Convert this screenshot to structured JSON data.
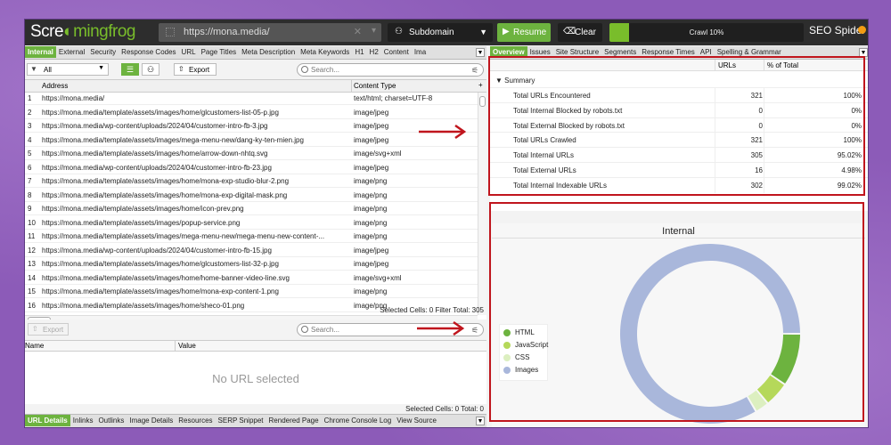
{
  "app": {
    "logo_pre": "Scre",
    "logo_mid": "ming",
    "logo_post": "frog",
    "url": "https://mona.media/",
    "mode": "Subdomain",
    "resume_label": "Resume",
    "clear_label": "Clear",
    "crawl_label": "Crawl 10%",
    "crawl_progress": 0.1,
    "product": "SEO Spider"
  },
  "left_tabs": [
    "Internal",
    "External",
    "Security",
    "Response Codes",
    "URL",
    "Page Titles",
    "Meta Description",
    "Meta Keywords",
    "H1",
    "H2",
    "Content",
    "Ima"
  ],
  "toolbar": {
    "filter": "All",
    "export_label": "Export",
    "search_placeholder": "Search..."
  },
  "grid": {
    "col_address": "Address",
    "col_content_type": "Content Type",
    "rows": [
      {
        "n": "1",
        "a": "https://mona.media/",
        "c": "text/html; charset=UTF-8"
      },
      {
        "n": "2",
        "a": "https://mona.media/template/assets/images/home/glcustomers-list-05-p.jpg",
        "c": "image/jpeg"
      },
      {
        "n": "3",
        "a": "https://mona.media/wp-content/uploads/2024/04/customer-intro-fb-3.jpg",
        "c": "image/jpeg"
      },
      {
        "n": "4",
        "a": "https://mona.media/template/assets/images/mega-menu-new/dang-ky-ten-mien.jpg",
        "c": "image/jpeg"
      },
      {
        "n": "5",
        "a": "https://mona.media/template/assets/images/home/arrow-down-nhtq.svg",
        "c": "image/svg+xml"
      },
      {
        "n": "6",
        "a": "https://mona.media/wp-content/uploads/2024/04/customer-intro-fb-23.jpg",
        "c": "image/jpeg"
      },
      {
        "n": "7",
        "a": "https://mona.media/template/assets/images/home/mona-exp-studio-blur-2.png",
        "c": "image/png"
      },
      {
        "n": "8",
        "a": "https://mona.media/template/assets/images/home/mona-exp-digital-mask.png",
        "c": "image/png"
      },
      {
        "n": "9",
        "a": "https://mona.media/template/assets/images/home/icon-prev.png",
        "c": "image/png"
      },
      {
        "n": "10",
        "a": "https://mona.media/template/assets/images/popup-service.png",
        "c": "image/png"
      },
      {
        "n": "11",
        "a": "https://mona.media/template/assets/images/mega-menu-new/mega-menu-new-content-...",
        "c": "image/png"
      },
      {
        "n": "12",
        "a": "https://mona.media/wp-content/uploads/2024/04/customer-intro-fb-15.jpg",
        "c": "image/jpeg"
      },
      {
        "n": "13",
        "a": "https://mona.media/template/assets/images/home/glcustomers-list-32-p.jpg",
        "c": "image/jpeg"
      },
      {
        "n": "14",
        "a": "https://mona.media/template/assets/images/home/home-banner-video-line.svg",
        "c": "image/svg+xml"
      },
      {
        "n": "15",
        "a": "https://mona.media/template/assets/images/home/mona-exp-content-1.png",
        "c": "image/png"
      },
      {
        "n": "16",
        "a": "https://mona.media/template/assets/images/home/sheco-01.png",
        "c": "image/png"
      }
    ],
    "status": "Selected Cells:  0  Filter Total:  305"
  },
  "detail": {
    "export_label": "Export",
    "search_placeholder": "Search...",
    "col_name": "Name",
    "col_value": "Value",
    "empty": "No URL selected",
    "status": "Selected Cells:  0  Total:  0"
  },
  "bottom_tabs": [
    "URL Details",
    "Inlinks",
    "Outlinks",
    "Image Details",
    "Resources",
    "SERP Snippet",
    "Rendered Page",
    "Chrome Console Log",
    "View Source"
  ],
  "right_tabs": [
    "Overview",
    "Issues",
    "Site Structure",
    "Segments",
    "Response Times",
    "API",
    "Spelling & Grammar"
  ],
  "overview": {
    "col_urls": "URLs",
    "col_pct": "% of Total",
    "summary": "Summary",
    "rows": [
      {
        "label": "Total URLs Encountered",
        "urls": "321",
        "pct": "100%"
      },
      {
        "label": "Total Internal Blocked by robots.txt",
        "urls": "0",
        "pct": "0%"
      },
      {
        "label": "Total External Blocked by robots.txt",
        "urls": "0",
        "pct": "0%"
      },
      {
        "label": "Total URLs Crawled",
        "urls": "321",
        "pct": "100%"
      },
      {
        "label": "Total Internal URLs",
        "urls": "305",
        "pct": "95.02%"
      },
      {
        "label": "Total External URLs",
        "urls": "16",
        "pct": "4.98%"
      },
      {
        "label": "Total Internal Indexable URLs",
        "urls": "302",
        "pct": "99.02%"
      }
    ]
  },
  "chart_data": {
    "type": "pie",
    "title": "Internal",
    "categories": [
      "HTML",
      "JavaScript",
      "CSS",
      "Images"
    ],
    "values": [
      9.5,
      4.5,
      2.5,
      83.5
    ],
    "colors": [
      "#6db33f",
      "#b5d85a",
      "#dcefc0",
      "#a9b7db"
    ],
    "legend": "left"
  },
  "icons": {
    "url_box": "grid-icon",
    "subdomain": "sitemap-icon",
    "resume": "play-icon",
    "clear": "eraser-icon",
    "notification": "bulb-icon"
  }
}
